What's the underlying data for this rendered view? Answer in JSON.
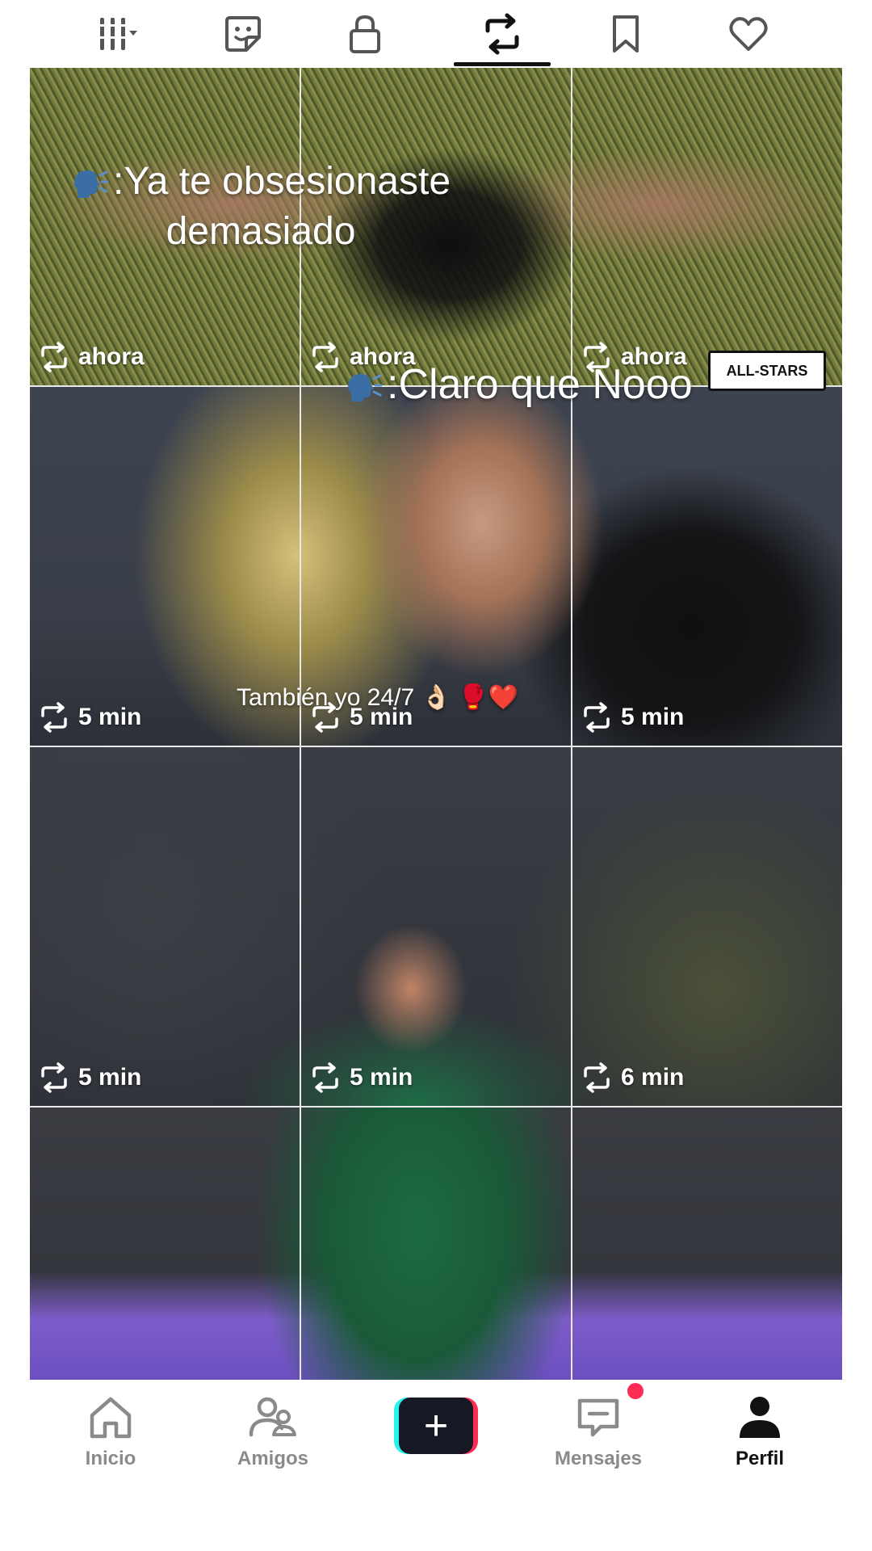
{
  "top_tabs": [
    {
      "name": "grid-menu",
      "icon": "grid-columns-dropdown-icon",
      "active": false
    },
    {
      "name": "effects",
      "icon": "sticker-face-icon",
      "active": false
    },
    {
      "name": "private",
      "icon": "lock-icon",
      "active": false
    },
    {
      "name": "reposts",
      "icon": "repost-icon",
      "active": true
    },
    {
      "name": "favorites",
      "icon": "bookmark-icon",
      "active": false
    },
    {
      "name": "liked",
      "icon": "heart-icon",
      "active": false
    }
  ],
  "overlays": {
    "text1": ":Ya te obsesionaste demasiado",
    "text2": ":Claro que Nooo",
    "text3": "También yo 24/7 👌🏻 🥊❤️",
    "logo": "ALL-STARS"
  },
  "grid": {
    "rows": [
      [
        "ahora",
        "ahora",
        "ahora"
      ],
      [
        "5 min",
        "5 min",
        "5 min"
      ],
      [
        "5 min",
        "5 min",
        "6 min"
      ],
      [
        "",
        "",
        ""
      ]
    ]
  },
  "bottom_nav": {
    "home": "Inicio",
    "friends": "Amigos",
    "create": "+",
    "inbox": "Mensajes",
    "profile": "Perfil"
  },
  "colors": {
    "accent_red": "#fe2c55",
    "accent_cyan": "#25f4ee",
    "active_text": "#111111",
    "inactive_text": "#8a8a8a"
  }
}
